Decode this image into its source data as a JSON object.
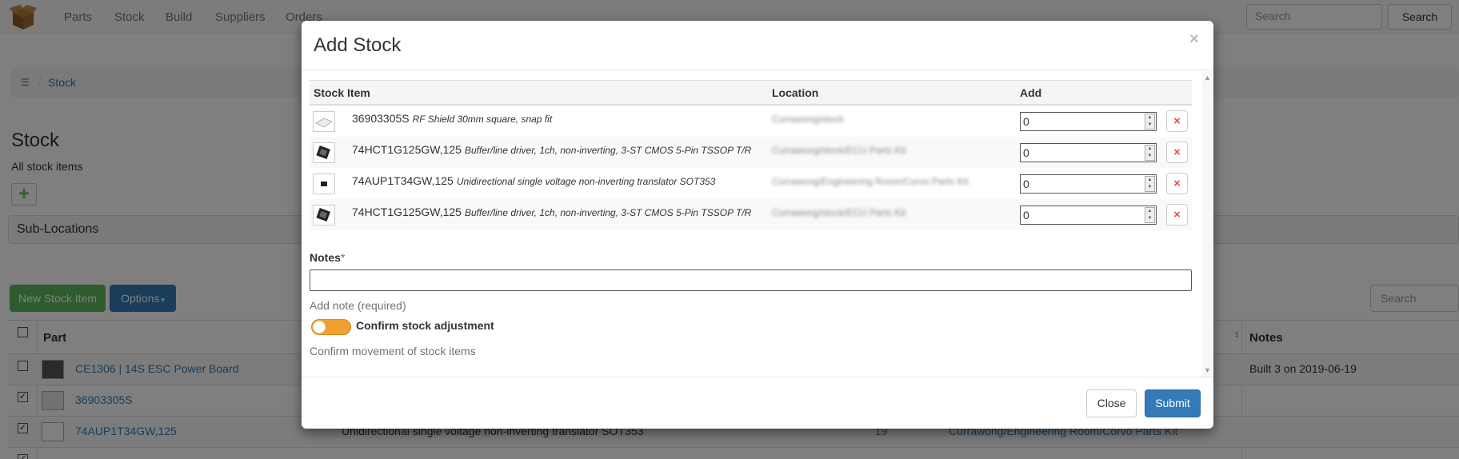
{
  "navbar": {
    "items": [
      "Parts",
      "Stock",
      "Build",
      "Suppliers",
      "Orders"
    ],
    "search_placeholder": "Search",
    "search_button": "Search"
  },
  "breadcrumb": {
    "current": "Stock"
  },
  "page": {
    "title": "Stock",
    "subtitle": "All stock items",
    "sublocations": "Sub-Locations",
    "new_stock_button": "New Stock Item",
    "options_button": "Options",
    "table_search_placeholder": "Search"
  },
  "background_table": {
    "headers": {
      "part": "Part",
      "notes": "Notes"
    },
    "rows": [
      {
        "checked": false,
        "part": "CE1306 | 14S ESC Power Board",
        "description": "",
        "quantity": "",
        "location": "",
        "notes": "Built 3 on 2019-06-19"
      },
      {
        "checked": true,
        "part": "36903305S",
        "description": "",
        "quantity": "",
        "location": "",
        "notes": ""
      },
      {
        "checked": true,
        "part": "74AUP1T34GW,125",
        "description": "Unidirectional single voltage non-inverting translator SOT353",
        "quantity": "19",
        "location": "Currawong/Engineering Room/Corvo Parts Kit",
        "notes": ""
      }
    ]
  },
  "modal": {
    "title": "Add Stock",
    "close_x": "×",
    "table": {
      "headers": {
        "item": "Stock Item",
        "location": "Location",
        "add": "Add"
      },
      "rows": [
        {
          "part": "36903305S",
          "description": "RF Shield 30mm square, snap fit",
          "location": "Currawong/stock",
          "add": "0"
        },
        {
          "part": "74HCT1G125GW,125",
          "description": "Buffer/line driver, 1ch, non-inverting, 3-ST CMOS 5-Pin TSSOP T/R",
          "location": "Currawong/stock/ECU Parts Kit",
          "add": "0"
        },
        {
          "part": "74AUP1T34GW,125",
          "description": "Unidirectional single voltage non-inverting translator SOT353",
          "location": "Currawong/Engineering Room/Corvo Parts Kit",
          "add": "0"
        },
        {
          "part": "74HCT1G125GW,125",
          "description": "Buffer/line driver, 1ch, non-inverting, 3-ST CMOS 5-Pin TSSOP T/R",
          "location": "Currawong/stock/ECU Parts Kit",
          "add": "0"
        }
      ],
      "delete_icon": "×"
    },
    "notes_label": "Notes",
    "notes_required_marker": "*",
    "notes_value": "",
    "notes_help": "Add note (required)",
    "confirm_label": "Confirm stock adjustment",
    "confirm_help": "Confirm movement of stock items",
    "close_button": "Close",
    "submit_button": "Submit"
  },
  "colors": {
    "primary": "#337ab7",
    "success": "#5cb85c",
    "danger": "#d9534f",
    "toggle": "#f0a030"
  }
}
